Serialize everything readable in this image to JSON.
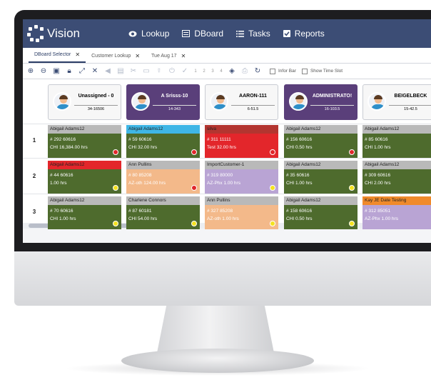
{
  "app": {
    "name": "Vision"
  },
  "nav": [
    {
      "label": "Lookup",
      "icon": "eye-icon"
    },
    {
      "label": "DBoard",
      "icon": "board-icon"
    },
    {
      "label": "Tasks",
      "icon": "list-icon"
    },
    {
      "label": "Reports",
      "icon": "check-square-icon"
    }
  ],
  "tabs": [
    {
      "label": "DBoard Selector",
      "close": "✕",
      "active": true
    },
    {
      "label": "Customer Lookup",
      "close": "✕",
      "active": false
    },
    {
      "label": "Tue Aug 17",
      "close": "✕",
      "active": false
    }
  ],
  "toolbar": {
    "pages": [
      "1",
      "2",
      "3",
      "4"
    ],
    "infor_bar": "Infor Bar",
    "show_time_slot": "Show Time Slot"
  },
  "columns": [
    {
      "name": "Unassigned - 0",
      "code": "34-16506",
      "style": "light"
    },
    {
      "name": "A Srisss-10",
      "code": "14-343",
      "style": "dark"
    },
    {
      "name": "AARON-111",
      "code": "6-51.5",
      "style": "light"
    },
    {
      "name": "ADMINISTRATO!",
      "code": "16-103.5",
      "style": "dark"
    },
    {
      "name": "BEIGELBECK",
      "code": "15-42.5",
      "style": "light"
    }
  ],
  "rows": [
    "1",
    "2",
    "3"
  ],
  "cards": [
    [
      {
        "title": "Abigail Adams12",
        "line1": "# 292 60616",
        "line2": "CHI 16,384.00 hrs",
        "title_color": "#b9b9b9",
        "body_color": "#4e6b2d",
        "dot": "#e0262a"
      },
      {
        "title": "Abigail Adams12",
        "line1": "# 59 60616",
        "line2": "CHI 32.00 hrs",
        "title_color": "#3fb6e6",
        "body_color": "#4e6b2d",
        "dot": "#e0262a"
      },
      {
        "title": "silva",
        "line1": "# 311 11111",
        "line2": "Test 32.00 hrs",
        "title_color": "#b33530",
        "body_color": "#e3262b",
        "dot": "#e0262a"
      },
      {
        "title": "Abigail Adams12",
        "line1": "# 156 60616",
        "line2": "CHI 0.50 hrs",
        "title_color": "#b9b9b9",
        "body_color": "#4e6b2d",
        "dot": "#e0262a"
      },
      {
        "title": "Abigail Adams12",
        "line1": "# 85 60616",
        "line2": "CHI 1.00 hrs",
        "title_color": "#b9b9b9",
        "body_color": "#4e6b2d",
        "dot": ""
      }
    ],
    [
      {
        "title": "Abigail Adams12",
        "line1": "# 44 60616",
        "line2": "1.00 hrs",
        "title_color": "#e3262b",
        "body_color": "#4e6b2d",
        "dot": "#f4e21f"
      },
      {
        "title": "Ann Pullins",
        "line1": "# 80 85208",
        "line2": "AZ-oth 124.00 hrs",
        "title_color": "#b9b9b9",
        "body_color": "#f3b98a",
        "dot": "#e0262a"
      },
      {
        "title": "ImportCustomer-1",
        "line1": "# 319 80000",
        "line2": "AZ-Phx 1.00 hrs",
        "title_color": "#b9b9b9",
        "body_color": "#b9a4d4",
        "dot": "#f4e21f"
      },
      {
        "title": "Abigail Adams12",
        "line1": "# 35 60616",
        "line2": "CHI 1.00 hrs",
        "title_color": "#b9b9b9",
        "body_color": "#4e6b2d",
        "dot": "#f4e21f"
      },
      {
        "title": "Abigail Adams12",
        "line1": "# 309 60616",
        "line2": "CHI 2.00 hrs",
        "title_color": "#b9b9b9",
        "body_color": "#4e6b2d",
        "dot": ""
      }
    ],
    [
      {
        "title": "Abigail Adams12",
        "line1": "# 70 60616",
        "line2": "CHI 1.00 hrs",
        "title_color": "#b9b9b9",
        "body_color": "#4e6b2d",
        "dot": "#f4e21f"
      },
      {
        "title": "Charlene Connors",
        "line1": "# 87 60181",
        "line2": "CHI 54.00 hrs",
        "title_color": "#b9b9b9",
        "body_color": "#4e6b2d",
        "dot": "#f4e21f"
      },
      {
        "title": "Ann Pullins",
        "line1": "# 327 85208",
        "line2": "AZ-oth 1.00 hrs",
        "title_color": "#b9b9b9",
        "body_color": "#f3b98a",
        "dot": "#f4e21f"
      },
      {
        "title": "Abigail Adams12",
        "line1": "# 158 60616",
        "line2": "CHI 0.50 hrs",
        "title_color": "#b9b9b9",
        "body_color": "#4e6b2d",
        "dot": "#f4e21f"
      },
      {
        "title": "Kay JE Date Testing",
        "line1": "# 312 85051",
        "line2": "AZ-Phx 1.00 hrs",
        "title_color": "#f08a2b",
        "body_color": "#b9a4d4",
        "dot": ""
      }
    ]
  ],
  "colors": {
    "topbar": "#3c4d75",
    "dark_header": "#5a3f7a"
  }
}
